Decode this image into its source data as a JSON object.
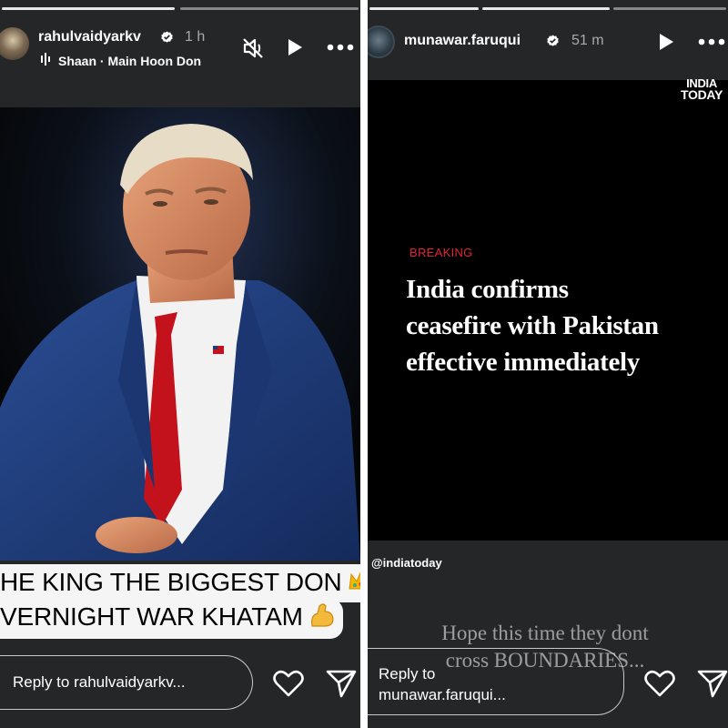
{
  "left_story": {
    "username": "rahulvaidyarkv",
    "time": "1 h",
    "music": "Shaan · Main Hoon Don",
    "caption_line1": "HE KING THE BIGGEST DON",
    "caption_line2": "VERNIGHT WAR KHATAM",
    "reply_placeholder": "Reply to rahulvaidyarkv...",
    "icons": [
      "mute-icon",
      "play-icon",
      "more-icon",
      "heart-icon",
      "send-icon",
      "verified-icon",
      "crown-emoji",
      "flexed-bicep-emoji"
    ]
  },
  "right_story": {
    "username": "munawar.faruqui",
    "time": "51 m",
    "brand_line1": "INDIA",
    "brand_line2": "TODAY",
    "breaking": "BREAKING",
    "headline_line1": "India confirms",
    "headline_line2": "ceasefire with Pakistan",
    "headline_line3": "effective immediately",
    "handle": "@indiatoday",
    "overlay_line1": "Hope this time they dont",
    "overlay_line2": "cross BOUNDARIES...",
    "reply_line1": "Reply to",
    "reply_line2": "munawar.faruqui...",
    "icons": [
      "play-icon",
      "more-icon",
      "heart-icon",
      "send-icon",
      "verified-icon"
    ]
  },
  "colors": {
    "background": "#252628",
    "breaking_red": "#e0253a",
    "tie_red": "#c4121d",
    "suit_blue": "#1f3c7a"
  }
}
